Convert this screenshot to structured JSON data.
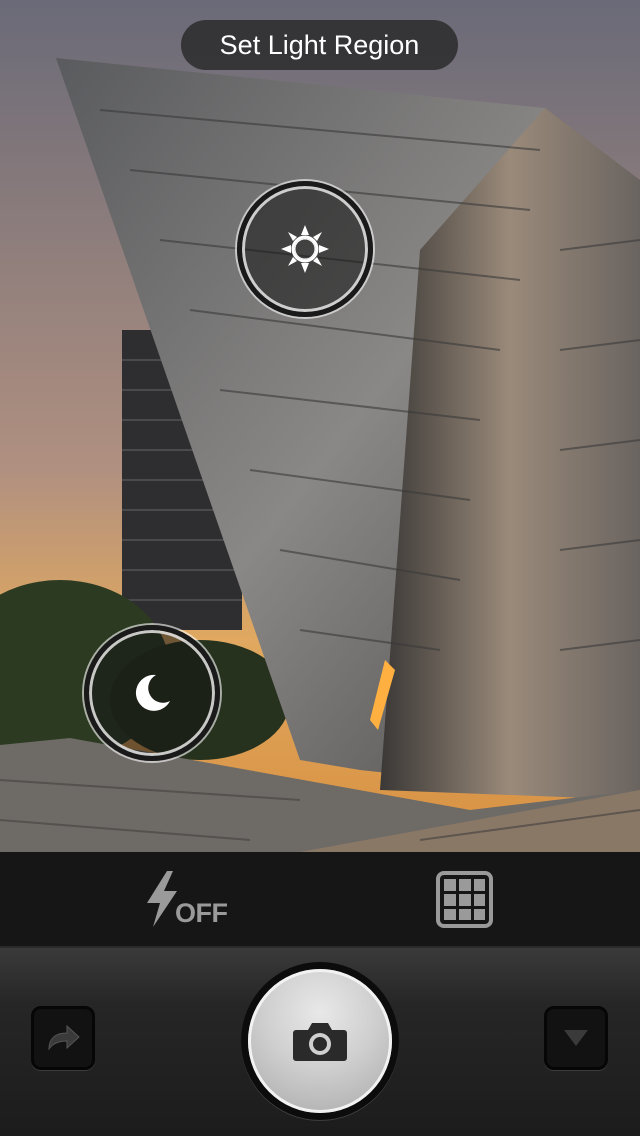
{
  "header": {
    "title": "Set Light Region"
  },
  "meters": {
    "light": {
      "icon": "sun-icon"
    },
    "dark": {
      "icon": "moon-icon"
    }
  },
  "toolbar": {
    "flash": {
      "icon": "flash-icon",
      "label": "OFF"
    },
    "grid": {
      "icon": "grid-icon"
    }
  },
  "controls": {
    "share": {
      "icon": "share-arrow-icon"
    },
    "shutter": {
      "icon": "camera-icon"
    },
    "more": {
      "icon": "triangle-down-icon"
    }
  },
  "colors": {
    "pill_bg": "#282828",
    "toolbar_bg": "#161616",
    "icon_gray": "#9a9a9a"
  }
}
